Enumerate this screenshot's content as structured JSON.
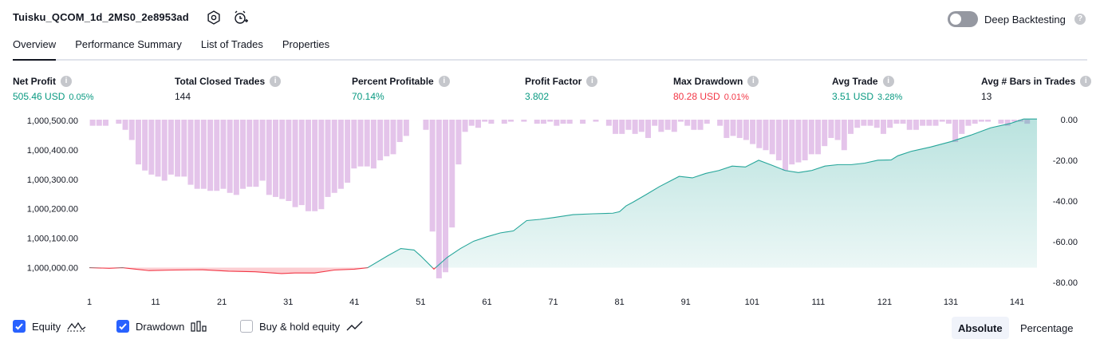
{
  "header": {
    "title": "Tuisku_QCOM_1d_2MS0_2e8953ad",
    "deep_backtesting_label": "Deep Backtesting",
    "deep_backtesting_on": false
  },
  "tabs": [
    {
      "label": "Overview",
      "active": true
    },
    {
      "label": "Performance Summary",
      "active": false
    },
    {
      "label": "List of Trades",
      "active": false
    },
    {
      "label": "Properties",
      "active": false
    }
  ],
  "metrics": [
    {
      "label": "Net Profit",
      "value": "505.46 USD",
      "sub": "0.05%",
      "color": "#089981"
    },
    {
      "label": "Total Closed Trades",
      "value": "144",
      "sub": "",
      "color": "#131722"
    },
    {
      "label": "Percent Profitable",
      "value": "70.14%",
      "sub": "",
      "color": "#089981"
    },
    {
      "label": "Profit Factor",
      "value": "3.802",
      "sub": "",
      "color": "#089981"
    },
    {
      "label": "Max Drawdown",
      "value": "80.28 USD",
      "sub": "0.01%",
      "color": "#f23645"
    },
    {
      "label": "Avg Trade",
      "value": "3.51 USD",
      "sub": "3.28%",
      "color": "#089981"
    },
    {
      "label": "Avg # Bars in Trades",
      "value": "13",
      "sub": "",
      "color": "#131722"
    }
  ],
  "legend": {
    "equity_label": "Equity",
    "drawdown_label": "Drawdown",
    "buy_hold_label": "Buy & hold equity",
    "equity_checked": true,
    "drawdown_checked": true,
    "buy_hold_checked": false
  },
  "view_toggle": {
    "absolute_label": "Absolute",
    "percentage_label": "Percentage",
    "selected": "Absolute"
  },
  "chart_data": {
    "type": "area",
    "colors": {
      "equity_positive": "#26a69a",
      "equity_negative": "#f23645",
      "drawdown": "#ce93d8"
    },
    "x_tick_labels": [
      "1",
      "11",
      "21",
      "31",
      "41",
      "51",
      "61",
      "71",
      "81",
      "91",
      "101",
      "111",
      "121",
      "131",
      "141"
    ],
    "left_axis": {
      "ticks": [
        "1,000,500.00",
        "1,000,400.00",
        "1,000,300.00",
        "1,000,200.00",
        "1,000,100.00",
        "1,000,000.00"
      ],
      "ylim": [
        999950,
        1000510
      ]
    },
    "right_axis": {
      "ticks": [
        "0.00",
        "-20.00",
        "-40.00",
        "-60.00",
        "-80.00"
      ],
      "ylim": [
        -82,
        2
      ]
    },
    "xlim": [
      1,
      144
    ],
    "equity": {
      "name": "Equity",
      "x": [
        1,
        4,
        6,
        8,
        10,
        14,
        18,
        22,
        26,
        30,
        32,
        35,
        38,
        41,
        43,
        46,
        48,
        50,
        51,
        53,
        55,
        57,
        59,
        61,
        63,
        65,
        67,
        69,
        71,
        74,
        77,
        80,
        81,
        82,
        83,
        85,
        87,
        90,
        92,
        94,
        96,
        98,
        100,
        102,
        104,
        106,
        108,
        110,
        112,
        114,
        116,
        118,
        120,
        122,
        123,
        125,
        128,
        131,
        134,
        137,
        140,
        142,
        144
      ],
      "y": [
        1000000,
        999998,
        1000000,
        999995,
        999990,
        999992,
        999993,
        999988,
        999986,
        999980,
        999982,
        999982,
        999992,
        999995,
        1000000,
        1000040,
        1000065,
        1000060,
        1000040,
        999995,
        1000035,
        1000065,
        1000090,
        1000105,
        1000118,
        1000125,
        1000160,
        1000164,
        1000170,
        1000180,
        1000183,
        1000185,
        1000190,
        1000210,
        1000222,
        1000248,
        1000275,
        1000310,
        1000305,
        1000320,
        1000330,
        1000345,
        1000342,
        1000365,
        1000348,
        1000330,
        1000323,
        1000330,
        1000345,
        1000350,
        1000350,
        1000355,
        1000365,
        1000366,
        1000380,
        1000395,
        1000410,
        1000428,
        1000450,
        1000475,
        1000490,
        1000505,
        1000505
      ]
    },
    "drawdown": {
      "name": "Drawdown",
      "values": [
        -3,
        -3,
        -3,
        0,
        -2,
        -5,
        -10,
        -22,
        -25,
        -27,
        -28,
        -30,
        -27,
        -28,
        -28,
        -32,
        -34,
        -34,
        -35,
        -35,
        -34,
        -36,
        -37,
        -34,
        -33,
        -33,
        -30,
        -37,
        -38,
        -39,
        -40,
        -43,
        -42,
        -45,
        -45,
        -44,
        -38,
        -36,
        -34,
        -31,
        -24,
        -23,
        -23,
        -24,
        -20,
        -18,
        -17,
        -11,
        -8,
        0,
        0,
        -5,
        -55,
        -78,
        -75,
        -53,
        -22,
        -6,
        -3,
        -4,
        -1,
        -2,
        0,
        -2,
        -1,
        0,
        -1,
        0,
        -2,
        -2,
        -1,
        -3,
        -2,
        -2,
        0,
        -2,
        0,
        -1,
        0,
        -3,
        -7,
        -7,
        -5,
        -7,
        -6,
        -9,
        -3,
        -6,
        -5,
        -6,
        -1,
        -3,
        -5,
        -5,
        -2,
        0,
        -3,
        -9,
        -8,
        -9,
        -10,
        -12,
        -14,
        -15,
        -17,
        -20,
        -25,
        -22,
        -21,
        -20,
        -17,
        -17,
        -13,
        -9,
        -10,
        -15,
        -7,
        -4,
        -3,
        -3,
        -4,
        -7,
        -4,
        -2,
        -2,
        -5,
        -5,
        -3,
        -3,
        -3,
        -1,
        -2,
        -11,
        -7,
        -3,
        -2,
        -1,
        -1,
        0,
        -2,
        -3,
        -1,
        -1,
        -2,
        0
      ]
    }
  }
}
